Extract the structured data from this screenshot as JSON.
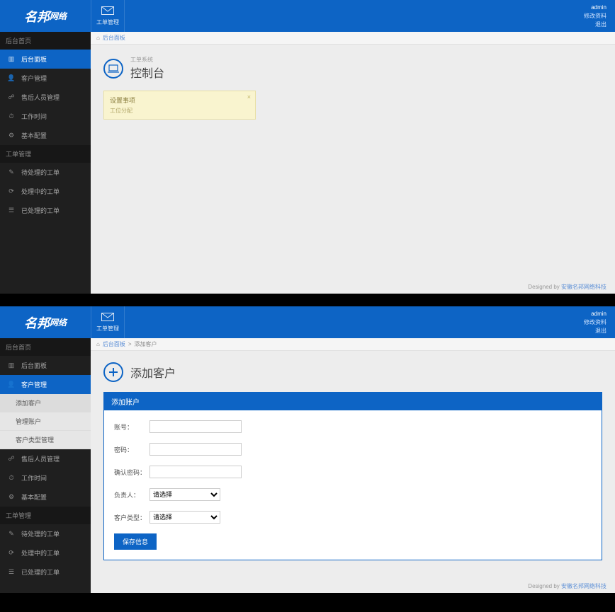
{
  "brand": {
    "main": "名邦",
    "sub": "网络"
  },
  "header": {
    "btn_label": "工单管理",
    "user_line": "admin",
    "link_profile": "修改资料",
    "link_logout": "退出"
  },
  "sidebar": {
    "group1": "后台首页",
    "i_home": "后台面板",
    "i_cust": "客户管理",
    "i_staff": "售后人员管理",
    "i_time": "工作时间",
    "i_set": "基本配置",
    "group2": "工单管理",
    "i_wait": "待处理的工单",
    "i_proc": "处理中的工单",
    "i_done": "已处理的工单",
    "sub_add": "添加客户",
    "sub_manage": "管理账户",
    "sub_type": "客户类型管理"
  },
  "crumb": {
    "home_icon": "⌂",
    "home": "后台面板",
    "sep": ">",
    "p2": "添加客户"
  },
  "screen1": {
    "subtitle": "工单系统",
    "title": "控制台",
    "alert_h": "设置事项",
    "alert_b": "工位分配"
  },
  "screen2": {
    "title": "添加客户",
    "panel_title": "添加账户",
    "f_acct": "账号：",
    "f_pwd": "密码：",
    "f_pwd2": "确认密码：",
    "f_owner": "负责人：",
    "f_type": "客户类型：",
    "opt_sel": "请选择",
    "btn": "保存信息"
  },
  "footer": {
    "pre": "Designed by ",
    "link": "安徽名邦网络科技"
  }
}
